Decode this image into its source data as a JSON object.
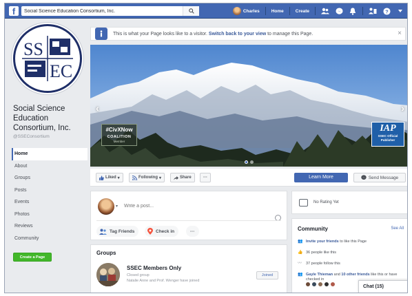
{
  "topbar": {
    "logo": "f",
    "search_value": "Social Science Education Consortium, Inc.",
    "user_name": "Charles",
    "home_label": "Home",
    "create_label": "Create"
  },
  "page": {
    "logo_text_top": "SS",
    "logo_text_bottom": "EC",
    "name": "Social Science Education Consortium, Inc.",
    "handle": "@SSEConsortium",
    "nav": [
      "Home",
      "About",
      "Groups",
      "Posts",
      "Events",
      "Photos",
      "Reviews",
      "Community"
    ],
    "create_page_label": "Create a Page"
  },
  "notice": {
    "text": "This is what your Page looks like to a visitor.",
    "link": "Switch back to your view",
    "suffix": "to manage this Page."
  },
  "cover": {
    "badge_left": {
      "line1": "#CivXNow",
      "line2": "COALITION",
      "line3": "Member"
    },
    "badge_right": {
      "line1": "IAP",
      "line2": "SSEC Official",
      "line3": "Publisher"
    }
  },
  "actions": {
    "liked": "Liked",
    "following": "Following",
    "share": "Share",
    "more": "···",
    "learn_more": "Learn More",
    "send_message": "Send Message"
  },
  "composer": {
    "placeholder": "Write a post...",
    "tag_friends": "Tag Friends",
    "check_in": "Check in",
    "more": "···"
  },
  "groups": {
    "title": "Groups",
    "name": "SSEC Members Only",
    "type": "Closed group",
    "members": "Natalie Anne and Prof. Wenger have joined",
    "joined": "Joined"
  },
  "rating": {
    "text": "No Rating Yet"
  },
  "community": {
    "title": "Community",
    "see_all": "See All",
    "invite": "Invite your friends",
    "invite_suffix": "to like this Page",
    "likes": "36 people like this",
    "follows": "37 people follow this",
    "friends_name": "Gayle Thieman",
    "friends_and": "and",
    "friends_link": "10 other friends",
    "friends_suffix": "like this or have checked in"
  },
  "chat": {
    "label": "Chat (15)"
  },
  "colors": {
    "brand": "#4267b2",
    "green": "#42b72a",
    "link": "#385898"
  }
}
